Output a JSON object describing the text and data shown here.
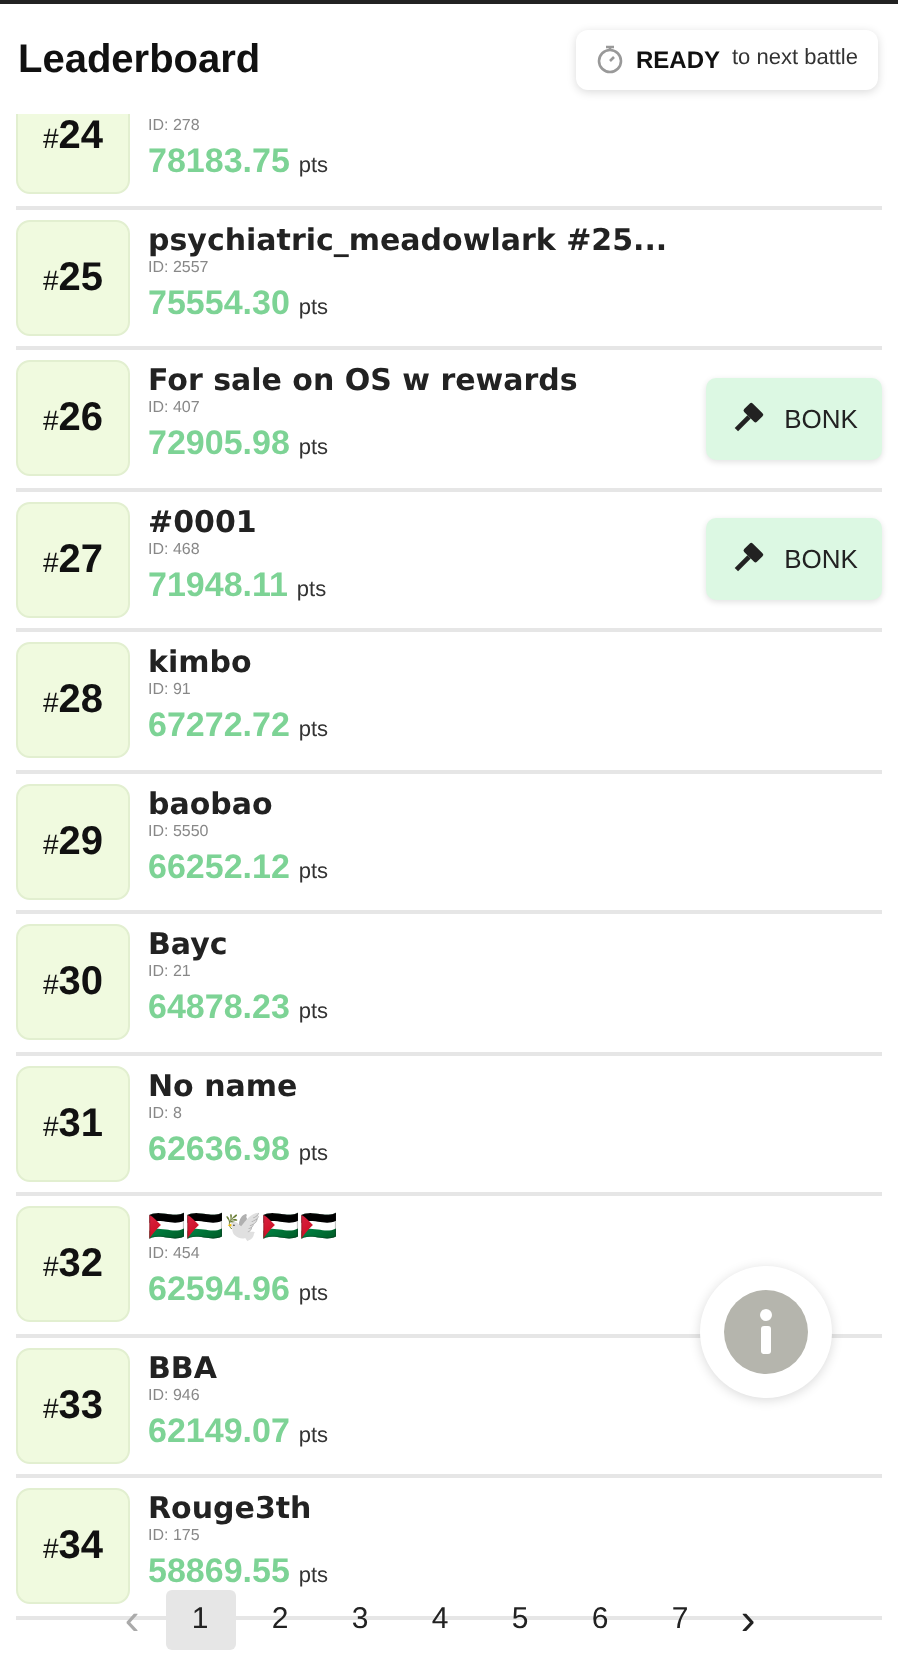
{
  "title": "Leaderboard",
  "status": {
    "strong": "READY",
    "rest": "to next battle"
  },
  "rows": [
    {
      "rank": "#24",
      "id": "ID: 278",
      "points": "78183.75",
      "unit": "pts",
      "bonk": false
    },
    {
      "rank": "#25",
      "name": "psychiatric_meadowlark #25...",
      "id": "ID: 2557",
      "points": "75554.30",
      "unit": "pts",
      "bonk": false
    },
    {
      "rank": "#26",
      "name": "For sale on OS w rewards",
      "id": "ID: 407",
      "points": "72905.98",
      "unit": "pts",
      "bonk": true,
      "bonk_label": "BONK"
    },
    {
      "rank": "#27",
      "name": "#0001",
      "id": "ID: 468",
      "points": "71948.11",
      "unit": "pts",
      "bonk": true,
      "bonk_label": "BONK"
    },
    {
      "rank": "#28",
      "name": "kimbo",
      "id": "ID: 91",
      "points": "67272.72",
      "unit": "pts",
      "bonk": false
    },
    {
      "rank": "#29",
      "name": "baobao",
      "id": "ID: 5550",
      "points": "66252.12",
      "unit": "pts",
      "bonk": false
    },
    {
      "rank": "#30",
      "name": "Bayc",
      "id": "ID: 21",
      "points": "64878.23",
      "unit": "pts",
      "bonk": false
    },
    {
      "rank": "#31",
      "name": "No name",
      "id": "ID: 8",
      "points": "62636.98",
      "unit": "pts",
      "bonk": false
    },
    {
      "rank": "#32",
      "name": "🇵🇸🇵🇸🕊️🇵🇸🇵🇸",
      "id": "ID: 454",
      "points": "62594.96",
      "unit": "pts",
      "bonk": false
    },
    {
      "rank": "#33",
      "name": "BBA",
      "id": "ID: 946",
      "points": "62149.07",
      "unit": "pts",
      "bonk": false
    },
    {
      "rank": "#34",
      "name": "Rouge3th",
      "id": "ID: 175",
      "points": "58869.55",
      "unit": "pts",
      "bonk": false
    }
  ],
  "pagination": {
    "prev": "‹",
    "next": "›",
    "pages": [
      {
        "label": "1",
        "selected": true
      },
      {
        "label": "2",
        "selected": false
      },
      {
        "label": "3",
        "selected": false
      },
      {
        "label": "4",
        "selected": false
      },
      {
        "label": "5",
        "selected": false
      },
      {
        "label": "6",
        "selected": false
      },
      {
        "label": "7",
        "selected": false
      }
    ]
  }
}
